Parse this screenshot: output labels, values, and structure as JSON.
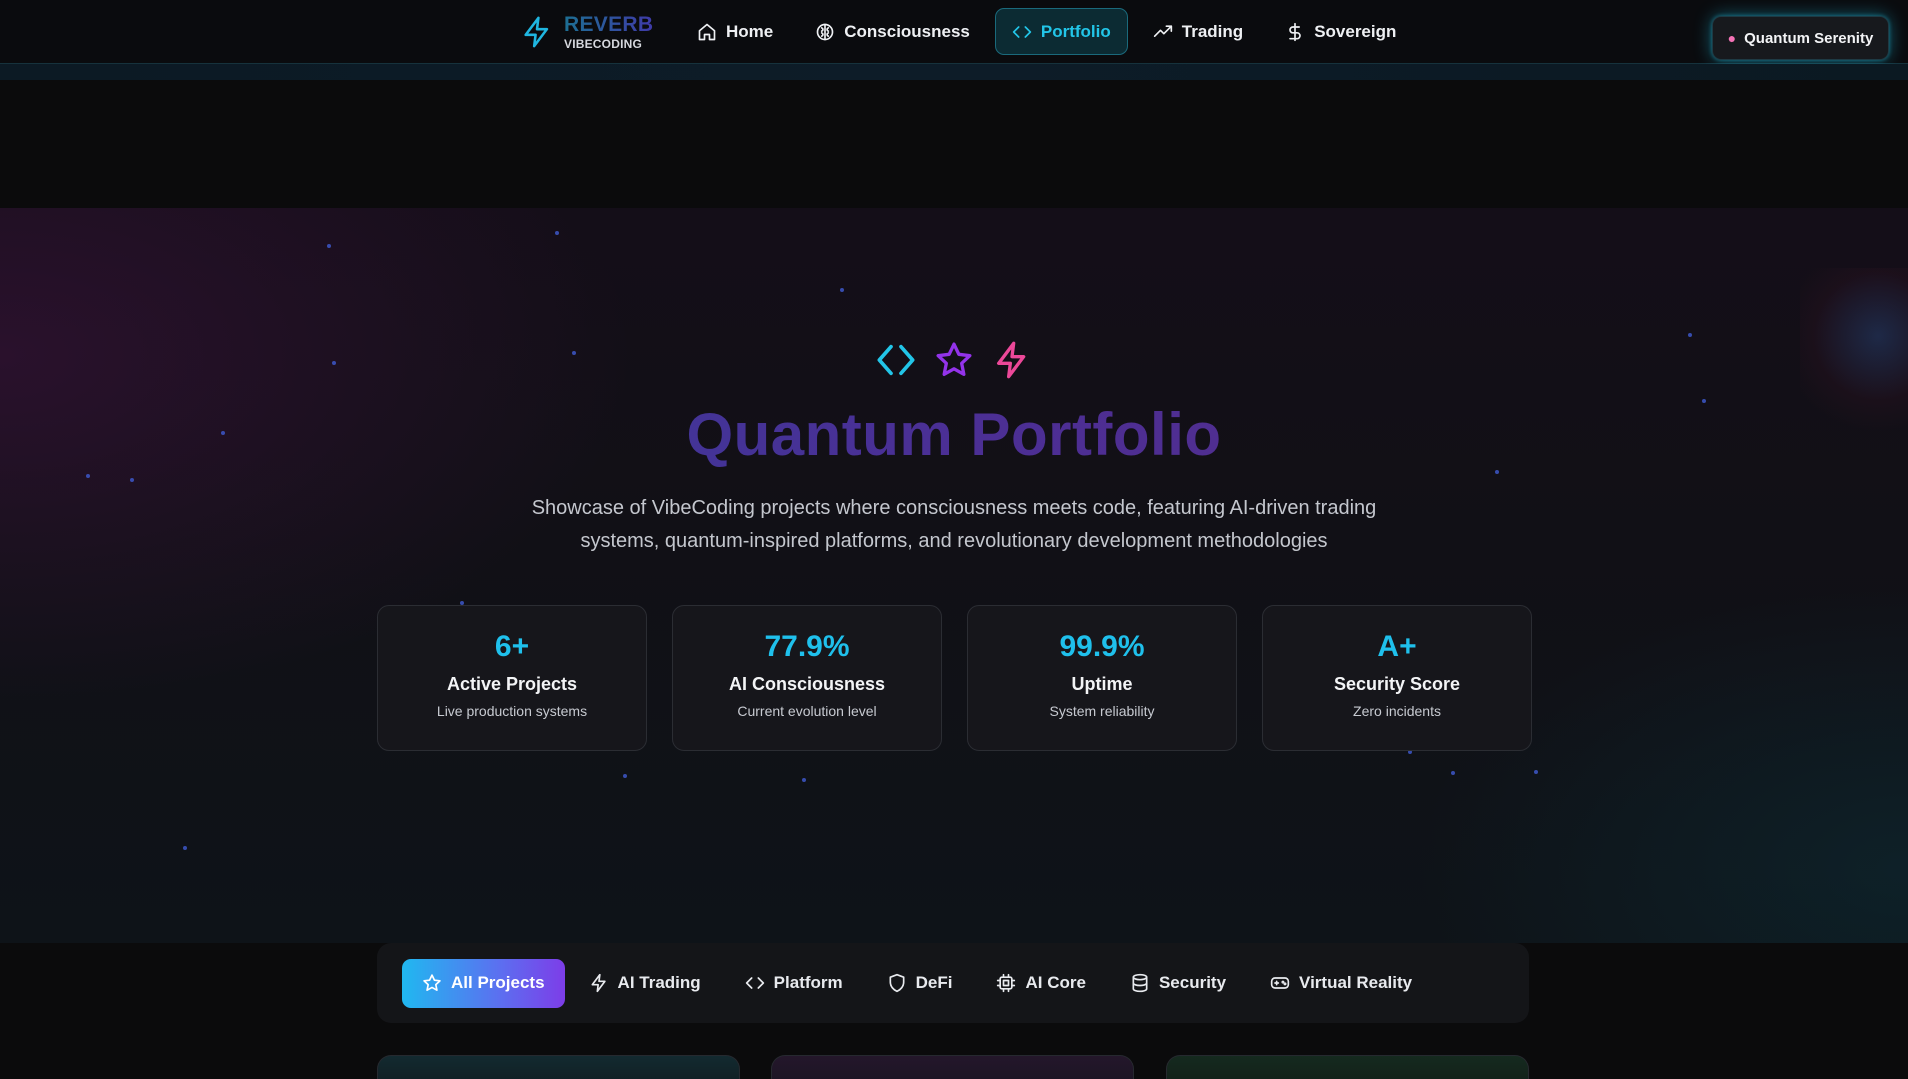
{
  "brand": {
    "name": "REVERB",
    "sub": "VIBECODING",
    "icon": "lightning-bolt-icon"
  },
  "nav": {
    "items": [
      {
        "label": "Home",
        "icon": "home-icon"
      },
      {
        "label": "Consciousness",
        "icon": "brain-icon"
      },
      {
        "label": "Portfolio",
        "icon": "code-icon",
        "active": true
      },
      {
        "label": "Trading",
        "icon": "trending-up-icon"
      },
      {
        "label": "Sovereign",
        "icon": "dollar-icon"
      }
    ],
    "mode_button": {
      "label": "Quantum Serenity",
      "icon": "brain-icon"
    }
  },
  "hero": {
    "icons": [
      "code-icon",
      "star-icon",
      "zap-icon"
    ],
    "title": "Quantum Portfolio",
    "subtitle": "Showcase of VibeCoding projects where consciousness meets code, featuring AI-driven trading systems, quantum-inspired platforms, and revolutionary development methodologies"
  },
  "stats": [
    {
      "value": "6+",
      "label": "Active Projects",
      "desc": "Live production systems"
    },
    {
      "value": "77.9%",
      "label": "AI Consciousness",
      "desc": "Current evolution level"
    },
    {
      "value": "99.9%",
      "label": "Uptime",
      "desc": "System reliability"
    },
    {
      "value": "A+",
      "label": "Security Score",
      "desc": "Zero incidents"
    }
  ],
  "filters": [
    {
      "label": "All Projects",
      "icon": "star-icon",
      "active": true
    },
    {
      "label": "AI Trading",
      "icon": "zap-icon"
    },
    {
      "label": "Platform",
      "icon": "code-icon"
    },
    {
      "label": "DeFi",
      "icon": "shield-icon"
    },
    {
      "label": "AI Core",
      "icon": "cpu-icon"
    },
    {
      "label": "Security",
      "icon": "database-icon"
    },
    {
      "label": "Virtual Reality",
      "icon": "gamepad-icon"
    }
  ],
  "colors": {
    "accent_cyan": "#22c5e8",
    "stat_value": "#1fc0ec",
    "star_purple": "#9333ea",
    "zap_pink": "#ec4899",
    "background": "#0b0b0c"
  }
}
